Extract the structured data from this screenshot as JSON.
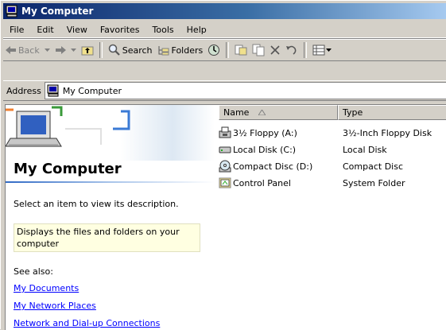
{
  "window": {
    "title": "My Computer"
  },
  "menu": [
    "File",
    "Edit",
    "View",
    "Favorites",
    "Tools",
    "Help"
  ],
  "toolbar": {
    "back": "Back",
    "search": "Search",
    "folders": "Folders"
  },
  "address": {
    "label": "Address",
    "value": "My Computer"
  },
  "left": {
    "title": "My Computer",
    "select_msg": "Select an item to view its description.",
    "desc": "Displays the files and folders on your computer",
    "see_also": "See also:",
    "links": [
      "My Documents",
      "My Network Places",
      "Network and Dial-up Connections"
    ]
  },
  "list": {
    "headers": [
      "Name",
      "Type"
    ],
    "items": [
      {
        "name": "3½ Floppy (A:)",
        "type": "3½-Inch Floppy Disk",
        "icon": "floppy-icon"
      },
      {
        "name": "Local Disk (C:)",
        "type": "Local Disk",
        "icon": "hard-disk-icon"
      },
      {
        "name": "Compact Disc (D:)",
        "type": "Compact Disc",
        "icon": "cd-drive-icon"
      },
      {
        "name": "Control Panel",
        "type": "System Folder",
        "icon": "control-panel-icon"
      }
    ]
  },
  "colors": {
    "title_start": "#0a246a",
    "title_end": "#a6caf0",
    "face": "#d4d0c8",
    "link": "#0000ff"
  }
}
